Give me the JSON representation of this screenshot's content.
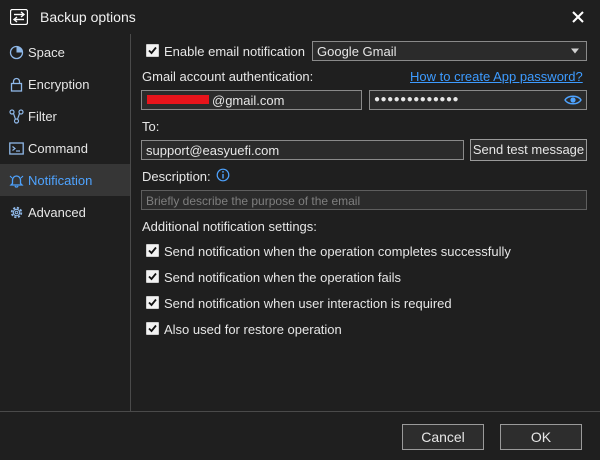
{
  "window": {
    "title": "Backup options"
  },
  "sidebar": {
    "items": [
      {
        "label": "Space",
        "icon": "pie-chart-icon"
      },
      {
        "label": "Encryption",
        "icon": "lock-icon"
      },
      {
        "label": "Filter",
        "icon": "filter-icon"
      },
      {
        "label": "Command",
        "icon": "terminal-icon"
      },
      {
        "label": "Notification",
        "icon": "bell-icon",
        "active": true
      },
      {
        "label": "Advanced",
        "icon": "gear-icon"
      }
    ]
  },
  "notification": {
    "enable_label": "Enable email notification",
    "enable_checked": true,
    "provider": "Google Gmail",
    "auth_label": "Gmail account authentication:",
    "app_password_link": "How to create App password?",
    "email_value": "@gmail.com",
    "password_value": "●●●●●●●●●●●●●",
    "to_label": "To:",
    "to_value": "support@easyuefi.com",
    "send_test_label": "Send test message",
    "description_label": "Description:",
    "description_placeholder": "Briefly describe the purpose of the email",
    "additional_label": "Additional notification settings:",
    "options": [
      {
        "label": "Send notification when the operation completes successfully",
        "checked": true
      },
      {
        "label": "Send notification when the operation fails",
        "checked": true
      },
      {
        "label": "Send notification when user interaction is required",
        "checked": true
      },
      {
        "label": "Also used for restore operation",
        "checked": true
      }
    ]
  },
  "footer": {
    "cancel_label": "Cancel",
    "ok_label": "OK"
  },
  "colors": {
    "accent": "#3d9bff",
    "background": "#1f1f1f",
    "active_item": "#363636"
  }
}
